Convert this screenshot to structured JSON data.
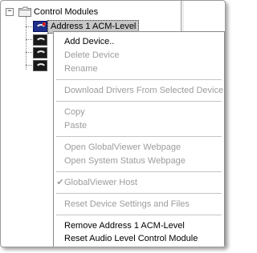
{
  "tree": {
    "root_expander": "−",
    "root_label": "Control Modules",
    "selected_label": "Address 1 ACM-Level"
  },
  "menu": {
    "add_device": "Add Device..",
    "delete_device": "Delete Device",
    "rename": "Rename",
    "download_drivers": "Download Drivers From Selected Device",
    "copy": "Copy",
    "paste": "Paste",
    "open_globalviewer": "Open GlobalViewer Webpage",
    "open_system_status": "Open System Status Webpage",
    "globalviewer_host_check": "✔",
    "globalviewer_host": "GlobalViewer Host",
    "reset_device_settings": "Reset Device Settings and Files",
    "remove_address": "Remove Address 1 ACM-Level",
    "reset_audio": "Reset Audio Level Control Module"
  }
}
